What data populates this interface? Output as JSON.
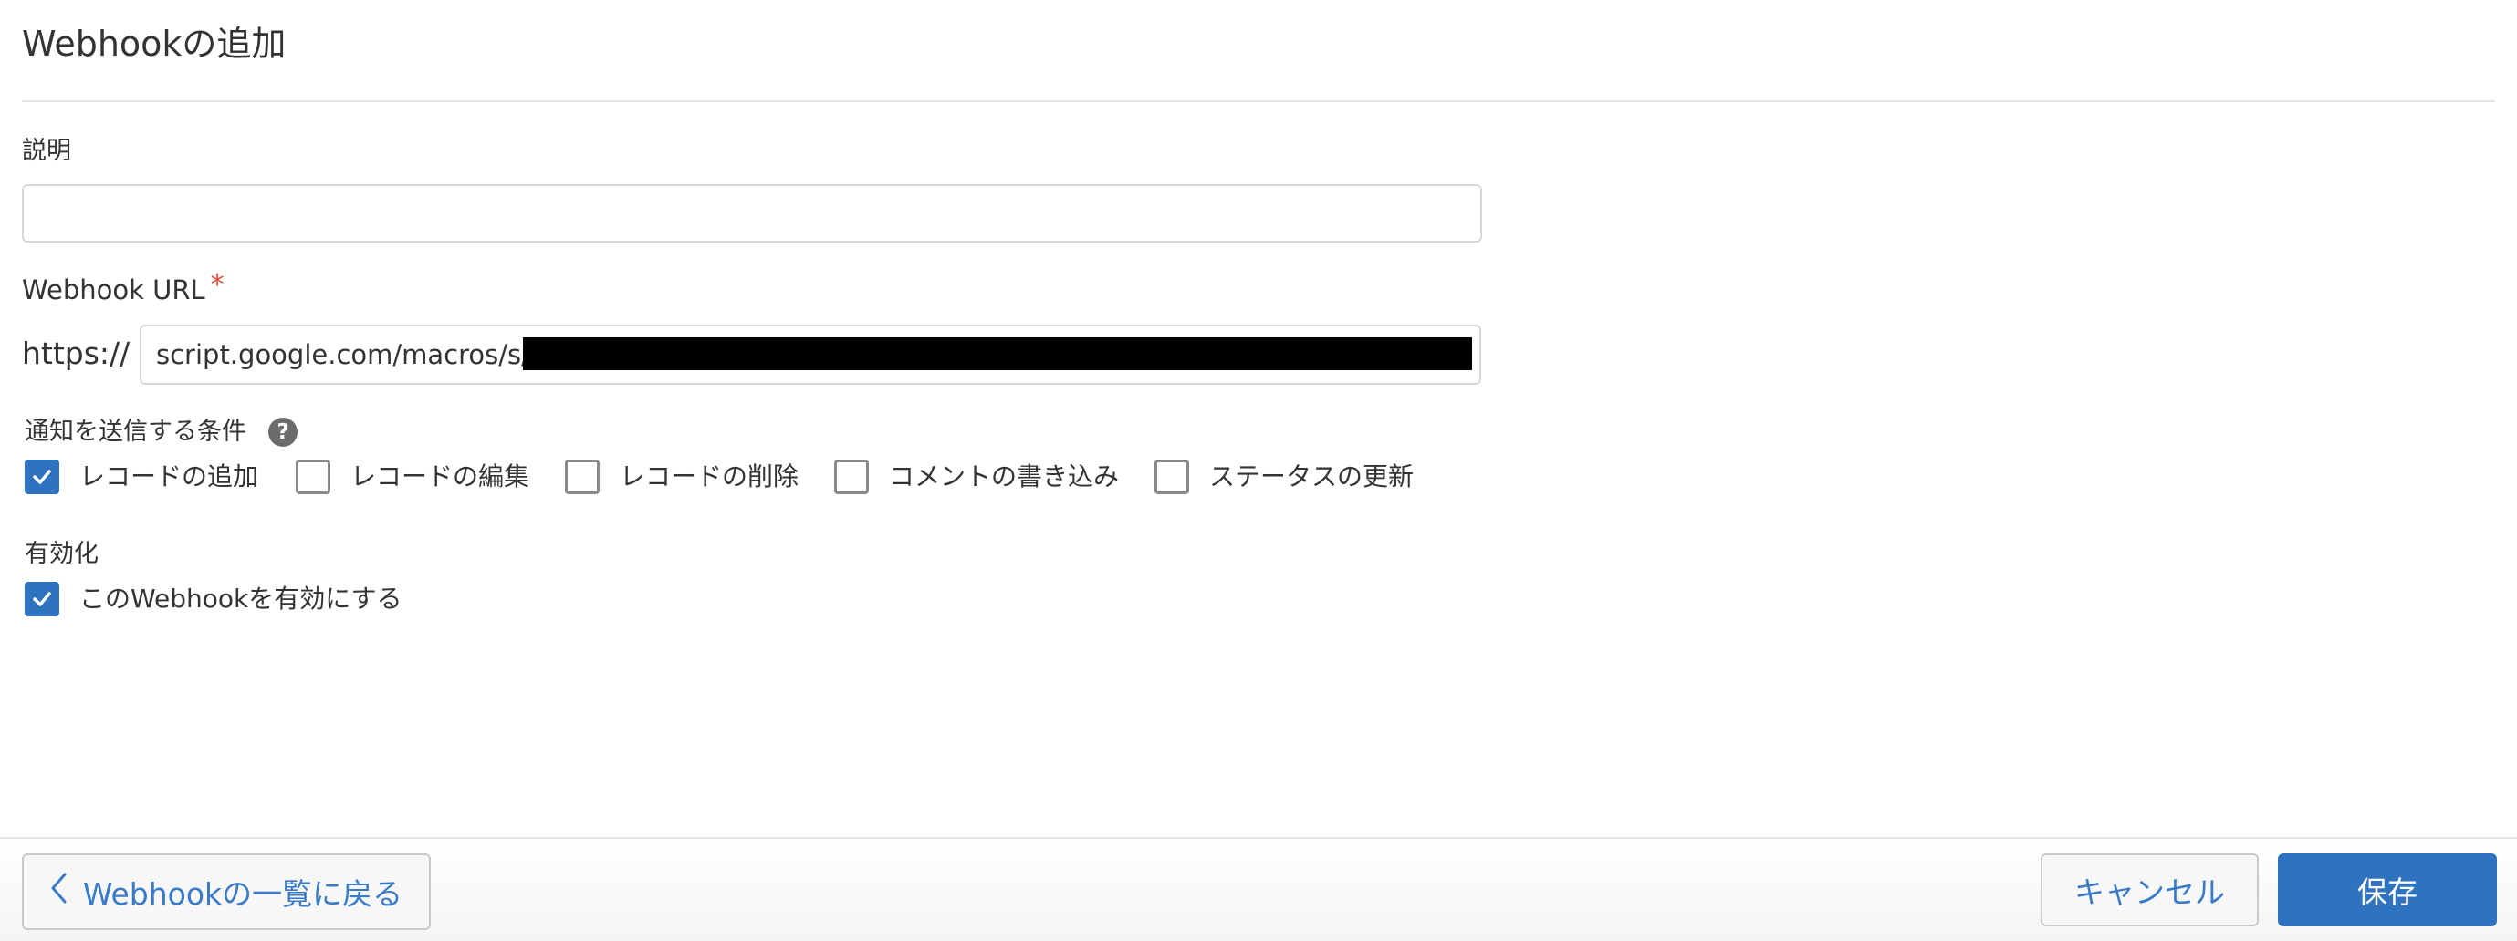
{
  "page": {
    "title": "Webhookの追加"
  },
  "description_field": {
    "label": "説明",
    "value": "",
    "placeholder": ""
  },
  "url_field": {
    "label": "Webhook URL",
    "required_mark": "*",
    "prefix": "https://",
    "value": "script.google.com/macros/s/"
  },
  "conditions": {
    "label": "通知を送信する条件",
    "help_icon": "question-circle-icon",
    "options": [
      {
        "label": "レコードの追加",
        "checked": true
      },
      {
        "label": "レコードの編集",
        "checked": false
      },
      {
        "label": "レコードの削除",
        "checked": false
      },
      {
        "label": "コメントの書き込み",
        "checked": false
      },
      {
        "label": "ステータスの更新",
        "checked": false
      }
    ]
  },
  "enable": {
    "label": "有効化",
    "checkbox_label": "このWebhookを有効にする",
    "checked": true
  },
  "footer": {
    "back_label": "Webhookの一覧に戻る",
    "cancel_label": "キャンセル",
    "save_label": "保存"
  },
  "colors": {
    "accent": "#2f72bf",
    "link": "#3a7bc8",
    "required": "#e74c3c"
  }
}
